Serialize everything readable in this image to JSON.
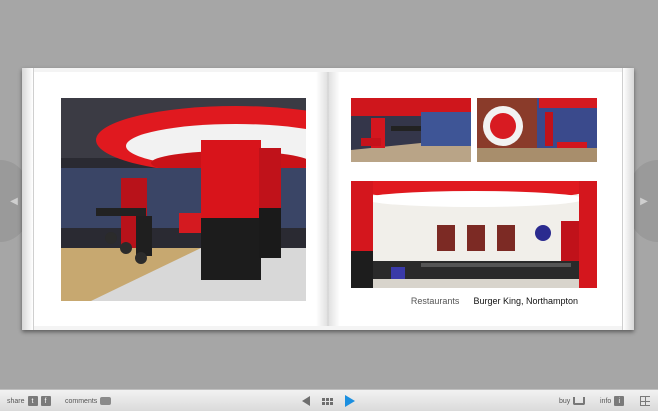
{
  "book": {
    "caption_category": "Restaurants",
    "caption_title": "Burger King, Northampton"
  },
  "toolbar": {
    "share_label": "share",
    "share_t": "t",
    "share_f": "f",
    "comments_label": "comments",
    "buy_label": "buy",
    "info_label": "info",
    "info_glyph": "i"
  },
  "icons": {
    "prev": "triangle-left-icon",
    "next": "triangle-right-icon",
    "grid": "grid-icon",
    "cart": "cart-icon",
    "fullscreen": "fullscreen-icon"
  },
  "colors": {
    "accent_red": "#e0191f",
    "play_blue": "#1b8fe0",
    "background": "#a6a6a6"
  }
}
